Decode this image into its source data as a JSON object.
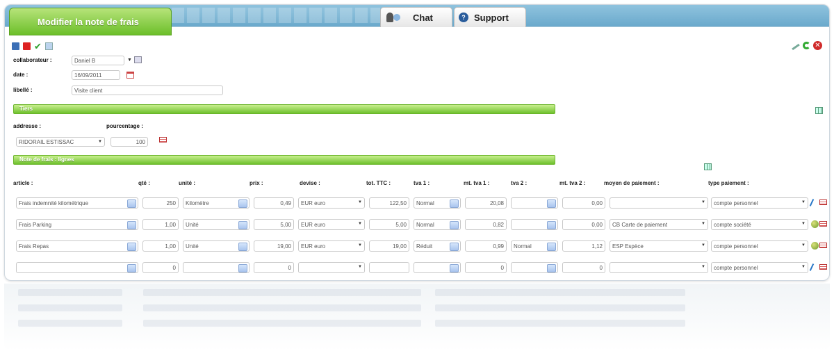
{
  "window": {
    "title": "Modifier la note de frais",
    "tabs": {
      "chat": "Chat",
      "support": "Support",
      "support_icon": "?"
    }
  },
  "form": {
    "collaborateur_label": "collaborateur :",
    "collaborateur_value": "Daniel B",
    "date_label": "date :",
    "date_value": "16/09/2011",
    "libelle_label": "libellé :",
    "libelle_value": "Visite client"
  },
  "tiers": {
    "section_title": "Tiers",
    "adresse_label": "addresse :",
    "pourcentage_label": "pourcentage :",
    "adresse_value": "RIDORAIL ESTISSAC",
    "pourcentage_value": "100"
  },
  "lignes": {
    "section_title": "Note de frais : lignes",
    "headers": {
      "article": "article :",
      "qte": "qté :",
      "unite": "unité :",
      "prix": "prix :",
      "devise": "devise :",
      "ttc": "tot. TTC :",
      "tva1": "tva 1 :",
      "mt1": "mt. tva 1 :",
      "tva2": "tva 2 :",
      "mt2": "mt. tva 2 :",
      "moyen": "moyen de paiement :",
      "type": "type paiement :"
    },
    "rows": [
      {
        "article": "Frais indemnité kilométrique",
        "qte": "250",
        "unite": "Kilomètre",
        "prix": "0,49",
        "devise": "EUR euro",
        "ttc": "122,50",
        "tva1": "Normal",
        "mt1": "20,08",
        "tva2": "",
        "mt2": "0,00",
        "moyen": "",
        "type": "compte personnel",
        "icon": "pencil-icon"
      },
      {
        "article": "Frais Parking",
        "qte": "1,00",
        "unite": "Unité",
        "prix": "5,00",
        "devise": "EUR euro",
        "ttc": "5,00",
        "tva1": "Normal",
        "mt1": "0,82",
        "tva2": "",
        "mt2": "0,00",
        "moyen": "CB Carte de paiement",
        "type": "compte société",
        "icon": "globe-icon"
      },
      {
        "article": "Frais Repas",
        "qte": "1,00",
        "unite": "Unité",
        "prix": "19,00",
        "devise": "EUR euro",
        "ttc": "19,00",
        "tva1": "Réduit",
        "mt1": "0,99",
        "tva2": "Normal",
        "mt2": "1,12",
        "moyen": "ESP Espèce",
        "type": "compte personnel",
        "icon": "globe-icon"
      },
      {
        "article": "",
        "qte": "0",
        "unite": "",
        "prix": "0",
        "devise": "",
        "ttc": "",
        "tva1": "",
        "mt1": "0",
        "tva2": "",
        "mt2": "0",
        "moyen": "",
        "type": "compte personnel",
        "icon": "pencil-icon"
      }
    ]
  }
}
